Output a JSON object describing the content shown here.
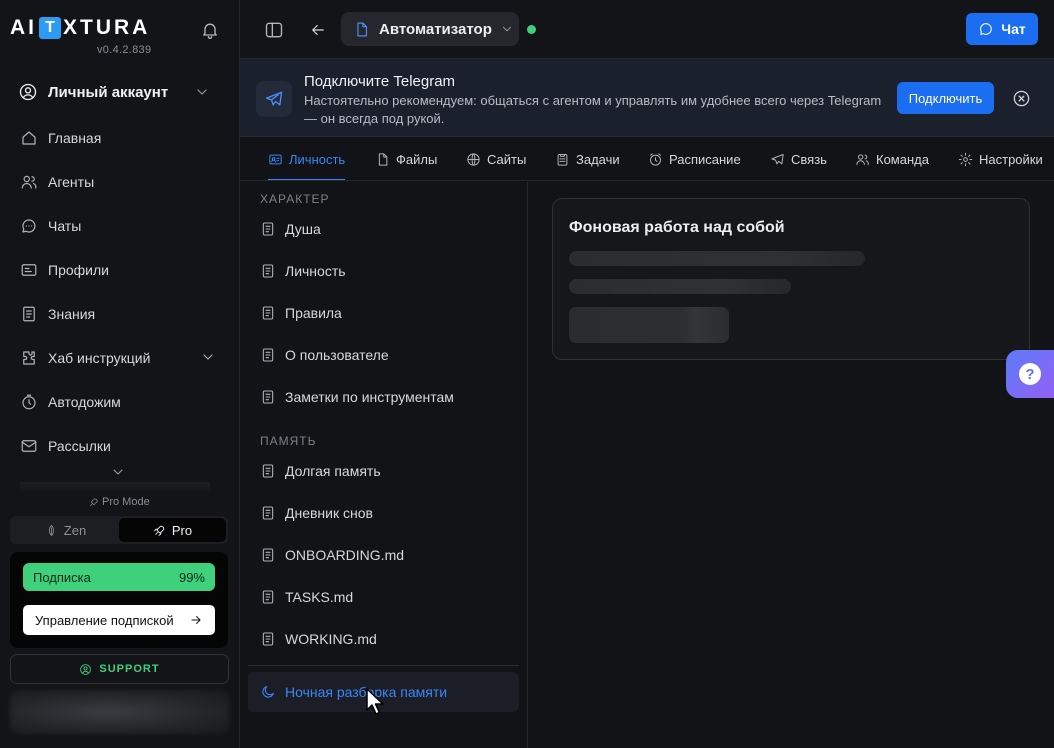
{
  "brand": {
    "logo_left": "AI",
    "logo_box": "T",
    "logo_right": "XTURA",
    "version": "v0.4.2.839"
  },
  "account": {
    "label": "Личный аккаунт"
  },
  "nav": {
    "items": [
      {
        "label": "Главная",
        "icon": "home-icon"
      },
      {
        "label": "Агенты",
        "icon": "users-icon"
      },
      {
        "label": "Чаты",
        "icon": "chat-icon"
      },
      {
        "label": "Профили",
        "icon": "profile-card-icon"
      },
      {
        "label": "Знания",
        "icon": "book-icon"
      },
      {
        "label": "Хаб инструкций",
        "icon": "puzzle-icon"
      },
      {
        "label": "Автодожим",
        "icon": "timer-icon"
      },
      {
        "label": "Рассылки",
        "icon": "mail-icon"
      }
    ]
  },
  "mode": {
    "caption": "Pro Mode",
    "zen": "Zen",
    "pro": "Pro",
    "selected": "Pro"
  },
  "subscription": {
    "label": "Подписка",
    "percent": "99%",
    "progress": 0.99,
    "manage": "Управление подпиской"
  },
  "support": {
    "label": "SUPPORT"
  },
  "topbar": {
    "agent_name": "Автоматизатор",
    "chat_label": "Чат",
    "status": "online"
  },
  "banner": {
    "title": "Подключите Telegram",
    "text": "Настоятельно рекомендуем: общаться с агентом и управлять им удобнее всего через Telegram — он всегда под рукой.",
    "button": "Подключить"
  },
  "tabs": [
    {
      "label": "Личность",
      "icon": "id-card-icon",
      "active": true
    },
    {
      "label": "Файлы",
      "icon": "file-icon"
    },
    {
      "label": "Сайты",
      "icon": "globe-icon"
    },
    {
      "label": "Задачи",
      "icon": "clipboard-icon"
    },
    {
      "label": "Расписание",
      "icon": "alarm-icon"
    },
    {
      "label": "Связь",
      "icon": "send-icon"
    },
    {
      "label": "Команда",
      "icon": "team-icon"
    },
    {
      "label": "Настройки",
      "icon": "gear-icon"
    }
  ],
  "files": {
    "character_label": "ХАРАКТЕР",
    "character": [
      "Душа",
      "Личность",
      "Правила",
      "О пользователе",
      "Заметки по инструментам"
    ],
    "memory_label": "ПАМЯТЬ",
    "memory": [
      "Долгая память",
      "Дневник снов",
      "ONBOARDING.md",
      "TASKS.md",
      "WORKING.md"
    ],
    "selected": "Ночная разборка памяти"
  },
  "main": {
    "card_title": "Фоновая работа над собой"
  },
  "colors": {
    "accent": "#1b6df2",
    "active_tab": "#3b86f7",
    "success": "#3fd07c",
    "background": "#121316"
  }
}
